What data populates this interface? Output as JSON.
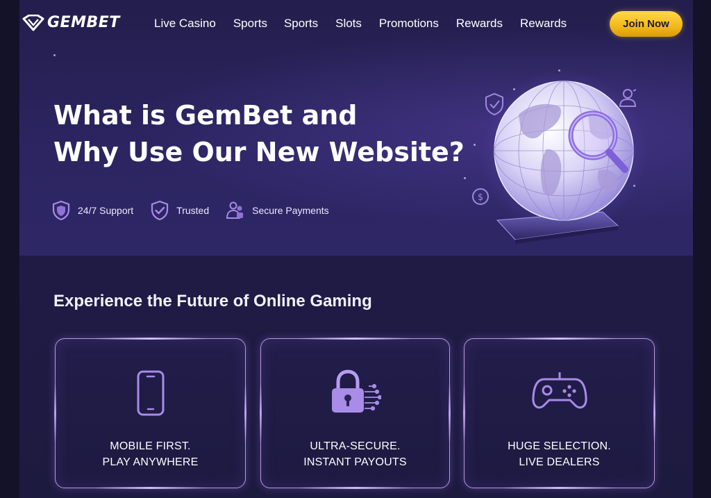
{
  "brand": {
    "name": "GEMBET",
    "icon": "gem-logo-icon"
  },
  "nav": {
    "links": [
      "Live Casino",
      "Sports",
      "Sports",
      "Slots",
      "Promotions",
      "Rewards",
      "Rewards"
    ],
    "cta": "Join Now"
  },
  "hero": {
    "title_line1": "What is GemBet and",
    "title_line2": "Why Use Our New Website?",
    "badges": [
      {
        "icon": "shield-icon",
        "label": "24/7 Support"
      },
      {
        "icon": "shield-check-icon",
        "label": "Trusted"
      },
      {
        "icon": "users-icon",
        "label": "Secure Payments"
      }
    ],
    "illustration": "globe-magnifier-illustration"
  },
  "features": {
    "title": "Experience the Future of Online Gaming",
    "cards": [
      {
        "icon": "smartphone-icon",
        "line1": "MOBILE FIRST.",
        "line2": "PLAY ANYWHERE"
      },
      {
        "icon": "padlock-icon",
        "line1": "ULTRA-SECURE.",
        "line2": "INSTANT PAYOUTS"
      },
      {
        "icon": "gamepad-icon",
        "line1": "HUGE SELECTION.",
        "line2": "LIVE DEALERS"
      }
    ]
  },
  "colors": {
    "accent": "#a98be8",
    "cta": "#f5c12a",
    "background": "#1d1a41"
  }
}
